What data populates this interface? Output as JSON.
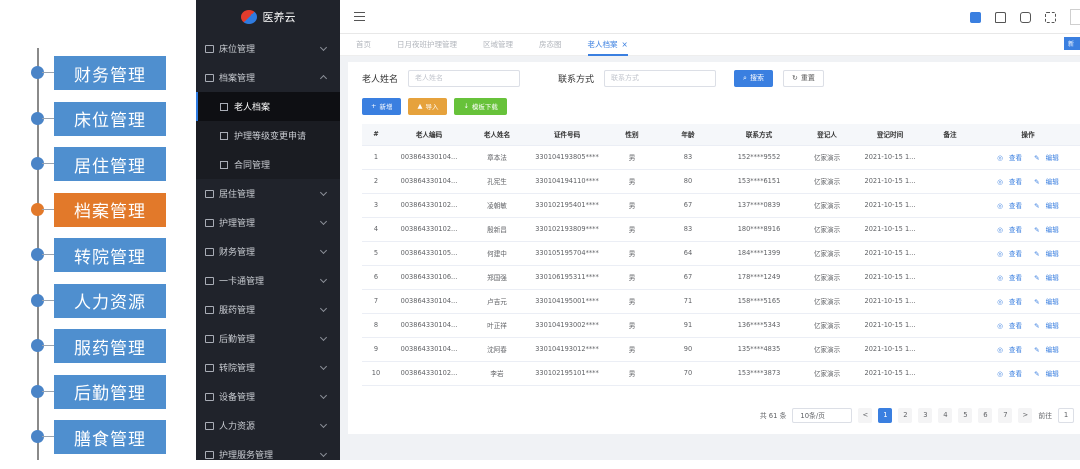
{
  "timeline": {
    "items": [
      {
        "label": "财务管理",
        "active": false
      },
      {
        "label": "床位管理",
        "active": false
      },
      {
        "label": "居住管理",
        "active": false
      },
      {
        "label": "档案管理",
        "active": true
      },
      {
        "label": "转院管理",
        "active": false
      },
      {
        "label": "人力资源",
        "active": false
      },
      {
        "label": "服药管理",
        "active": false
      },
      {
        "label": "后勤管理",
        "active": false
      },
      {
        "label": "膳食管理",
        "active": false
      }
    ],
    "colors": {
      "box": "#4f8fcf",
      "active": "#e2792a",
      "line": "#8a8a8a"
    }
  },
  "sidebar": {
    "logo_text": "医养云",
    "menu": [
      {
        "label": "床位管理",
        "expanded": false
      },
      {
        "label": "档案管理",
        "expanded": true,
        "children": [
          {
            "label": "老人档案",
            "active": true
          },
          {
            "label": "护理等级变更申请",
            "active": false
          },
          {
            "label": "合同管理",
            "active": false
          }
        ]
      },
      {
        "label": "居住管理",
        "expanded": false
      },
      {
        "label": "护理管理",
        "expanded": false
      },
      {
        "label": "财务管理",
        "expanded": false
      },
      {
        "label": "一卡通管理",
        "expanded": false
      },
      {
        "label": "服药管理",
        "expanded": false
      },
      {
        "label": "后勤管理",
        "expanded": false
      },
      {
        "label": "转院管理",
        "expanded": false
      },
      {
        "label": "设备管理",
        "expanded": false
      },
      {
        "label": "人力资源",
        "expanded": false
      },
      {
        "label": "护理服务管理",
        "expanded": false
      }
    ]
  },
  "tabs": [
    {
      "label": "首页",
      "active": false
    },
    {
      "label": "日月夜班护理管理",
      "active": false
    },
    {
      "label": "区域管理",
      "active": false
    },
    {
      "label": "房态图",
      "active": false
    },
    {
      "label": "老人档案",
      "active": true
    }
  ],
  "tab_close": "×",
  "topbar": {
    "new_button_label": "新"
  },
  "search": {
    "name_label": "老人姓名",
    "name_placeholder": "老人姓名",
    "phone_label": "联系方式",
    "phone_placeholder": "联系方式",
    "search_button": "搜索",
    "reset_button": "重置"
  },
  "actions": {
    "add": "新增",
    "import": "导入",
    "template": "模板下载"
  },
  "table": {
    "headers": [
      "#",
      "老人编码",
      "老人姓名",
      "证件号码",
      "性别",
      "年龄",
      "联系方式",
      "登记人",
      "登记时间",
      "备注",
      "操作"
    ],
    "view_label": "查看",
    "edit_label": "编辑",
    "rows": [
      [
        "1",
        "003864330104...",
        "章本法",
        "330104193805****",
        "男",
        "83",
        "152****9552",
        "亿家演示",
        "2021-10-15 1...",
        ""
      ],
      [
        "2",
        "003864330104...",
        "孔宪生",
        "330104194110****",
        "男",
        "80",
        "153****6151",
        "亿家演示",
        "2021-10-15 1...",
        ""
      ],
      [
        "3",
        "003864330102...",
        "凌朝敏",
        "330102195401****",
        "男",
        "67",
        "137****0839",
        "亿家演示",
        "2021-10-15 1...",
        ""
      ],
      [
        "4",
        "003864330102...",
        "殷新昌",
        "330102193809****",
        "男",
        "83",
        "180****8916",
        "亿家演示",
        "2021-10-15 1...",
        ""
      ],
      [
        "5",
        "003864330105...",
        "何建中",
        "330105195704****",
        "男",
        "64",
        "184****1399",
        "亿家演示",
        "2021-10-15 1...",
        ""
      ],
      [
        "6",
        "003864330106...",
        "郑国强",
        "330106195311****",
        "男",
        "67",
        "178****1249",
        "亿家演示",
        "2021-10-15 1...",
        ""
      ],
      [
        "7",
        "003864330104...",
        "卢吉元",
        "330104195001****",
        "男",
        "71",
        "158****5165",
        "亿家演示",
        "2021-10-15 1...",
        ""
      ],
      [
        "8",
        "003864330104...",
        "叶正祥",
        "330104193002****",
        "男",
        "91",
        "136****5343",
        "亿家演示",
        "2021-10-15 1...",
        ""
      ],
      [
        "9",
        "003864330104...",
        "沈阿春",
        "330104193012****",
        "男",
        "90",
        "135****4835",
        "亿家演示",
        "2021-10-15 1...",
        ""
      ],
      [
        "10",
        "003864330102...",
        "李岩",
        "330102195101****",
        "男",
        "70",
        "153****3873",
        "亿家演示",
        "2021-10-15 1...",
        ""
      ]
    ]
  },
  "pagination": {
    "total_text": "共 61 条",
    "page_size": "10条/页",
    "pages": [
      "1",
      "2",
      "3",
      "4",
      "5",
      "6",
      "7"
    ],
    "current": "1",
    "prev": "<",
    "next": ">",
    "jump_label": "前往",
    "jump_value": "1"
  },
  "colors": {
    "primary": "#3a7fe0",
    "sidebar_bg": "#20232b",
    "orange": "#e6a23c",
    "green": "#67c23a"
  }
}
